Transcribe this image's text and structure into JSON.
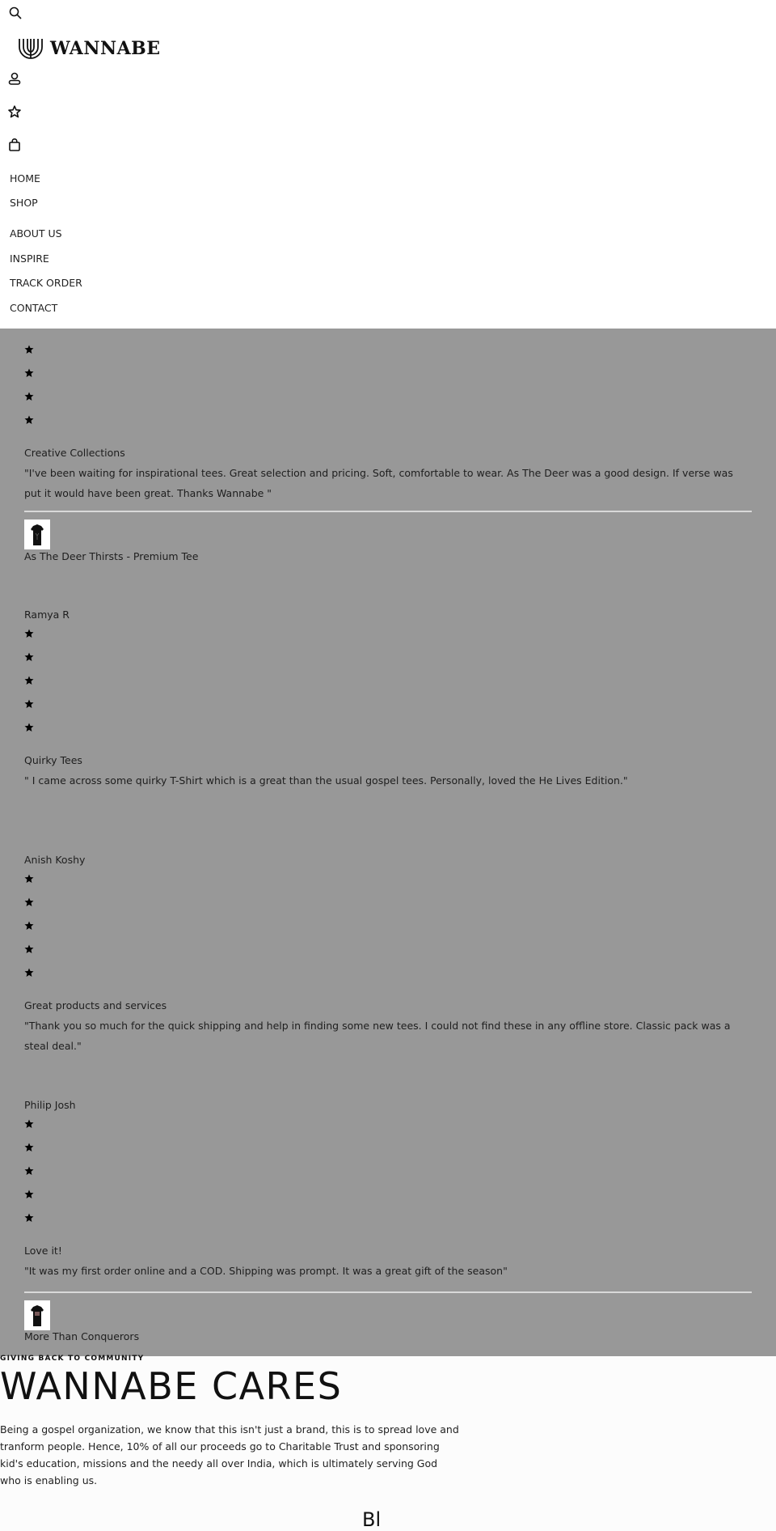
{
  "header": {
    "brand": "WANNABE",
    "icons": {
      "search": "search-icon",
      "account": "user-icon",
      "wishlist": "star-outline-icon",
      "cart": "shopping-bag-icon"
    },
    "nav": [
      {
        "label": "HOME"
      },
      {
        "label": "SHOP"
      },
      {
        "label": "ABOUT US"
      },
      {
        "label": "INSPIRE"
      },
      {
        "label": "TRACK ORDER"
      },
      {
        "label": "CONTACT"
      }
    ]
  },
  "reviews": [
    {
      "author": "",
      "rating": 4,
      "title": "Creative Collections",
      "body": "\"I've been waiting for inspirational tees. Great selection and pricing. Soft, comfortable to wear. As The Deer was a good design. If verse was put it would have been great. Thanks Wannabe \"",
      "product": "As The Deer Thirsts - Premium Tee"
    },
    {
      "author": "Ramya R",
      "rating": 5,
      "title": "Quirky Tees",
      "body": "\" I came across some quirky T-Shirt which is a great than the usual gospel tees. Personally, loved the He Lives Edition.\"",
      "product": ""
    },
    {
      "author": "Anish Koshy",
      "rating": 5,
      "title": "Great products and services",
      "body": "\"Thank you so much for the quick shipping and help in finding some new tees. I could not find these in any offline store. Classic pack was a steal deal.\"",
      "product": ""
    },
    {
      "author": "Philip Josh",
      "rating": 5,
      "title": "Love it!",
      "body": "\"It was my first order online and a COD. Shipping was prompt. It was a great gift of the season\"",
      "product": "More Than Conquerors"
    }
  ],
  "cares": {
    "eyebrow": "GIVING BACK TO COMMUNITY",
    "title": "WANNABE CARES",
    "body": "Being a gospel organization, we know that this isn't just a brand, this is to spread love and tranform people. Hence, 10% of all our proceeds go to Charitable Trust and sponsoring kid's education, missions and the needy all over India, which is ultimately serving God who is enabling us.",
    "next_heading_partial": "Bl"
  },
  "colors": {
    "header_bg": "#ffffff",
    "overlay_bg": "#989898",
    "page_bg": "#fcfcfc",
    "text": "#1e1e1e",
    "divider": "#d9d9d9"
  }
}
